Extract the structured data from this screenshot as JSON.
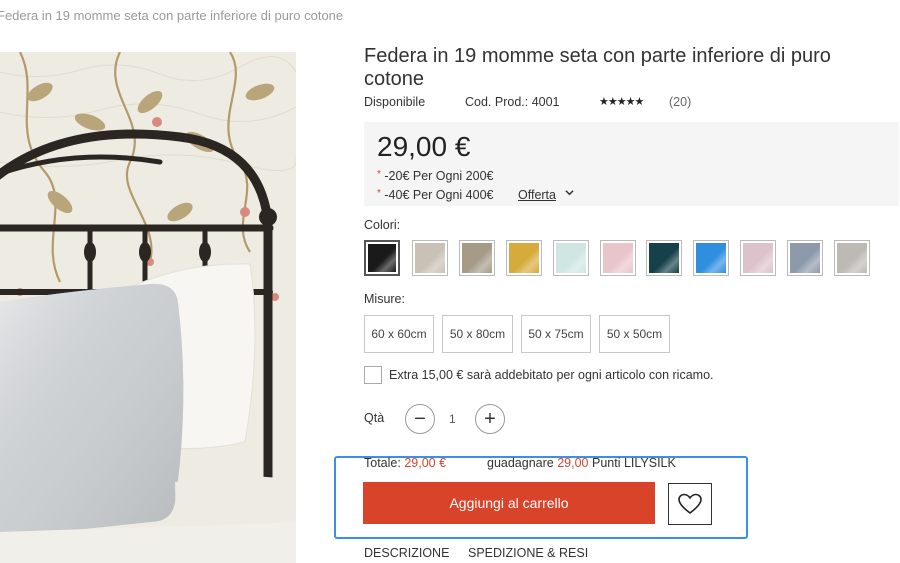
{
  "breadcrumb": {
    "current": "Federa in 19 momme seta con parte inferiore di puro cotone"
  },
  "product": {
    "title": "Federa in 19 momme seta con parte inferiore di puro cotone",
    "availability": "Disponibile",
    "code": "Cod. Prod.: 4001",
    "stars": "★★★★★",
    "review_count": "(20)",
    "rating": 5
  },
  "pricing": {
    "price": "29,00 €",
    "promo_1": "-20€ Per Ogni 200€",
    "promo_2": "-40€ Per Ogni 400€",
    "offer_link": "Offerta",
    "promo_marker": "*"
  },
  "colors": {
    "label": "Colori:",
    "swatches": [
      {
        "name": "black",
        "hex": "#1a1a1a"
      },
      {
        "name": "light-taupe",
        "hex": "#c9c1b5"
      },
      {
        "name": "taupe",
        "hex": "#a59b87"
      },
      {
        "name": "gold",
        "hex": "#d6ab3c"
      },
      {
        "name": "mint",
        "hex": "#cfe6e3"
      },
      {
        "name": "pink",
        "hex": "#e8c4cb"
      },
      {
        "name": "dark-teal",
        "hex": "#16414a"
      },
      {
        "name": "blue",
        "hex": "#2f8fde"
      },
      {
        "name": "blush",
        "hex": "#dcc3cb"
      },
      {
        "name": "slate",
        "hex": "#8c9aab"
      },
      {
        "name": "silver",
        "hex": "#bdbab6"
      }
    ]
  },
  "sizes": {
    "label": "Misure:",
    "options": [
      "60 x 60cm",
      "50 x 80cm",
      "50 x 75cm",
      "50 x 50cm"
    ]
  },
  "embroidery": {
    "label": "Extra 15,00 € sarà addebitato per ogni articolo con ricamo."
  },
  "quantity": {
    "label": "Qtà",
    "value": "1",
    "minus": "−",
    "plus": "+"
  },
  "totals": {
    "total_label": "Totale:",
    "total_value": "29,00 €",
    "earn_label": "guadagnare",
    "earn_value": "29,00",
    "points_label": "Punti LILYSILK"
  },
  "actions": {
    "add_to_cart": "Aggiungi al carrello"
  },
  "tabs": {
    "description": "DESCRIZIONE",
    "shipping": "SPEDIZIONE & RESI"
  },
  "accent_color": "#d9432a",
  "highlight_color": "#3b8fe6"
}
